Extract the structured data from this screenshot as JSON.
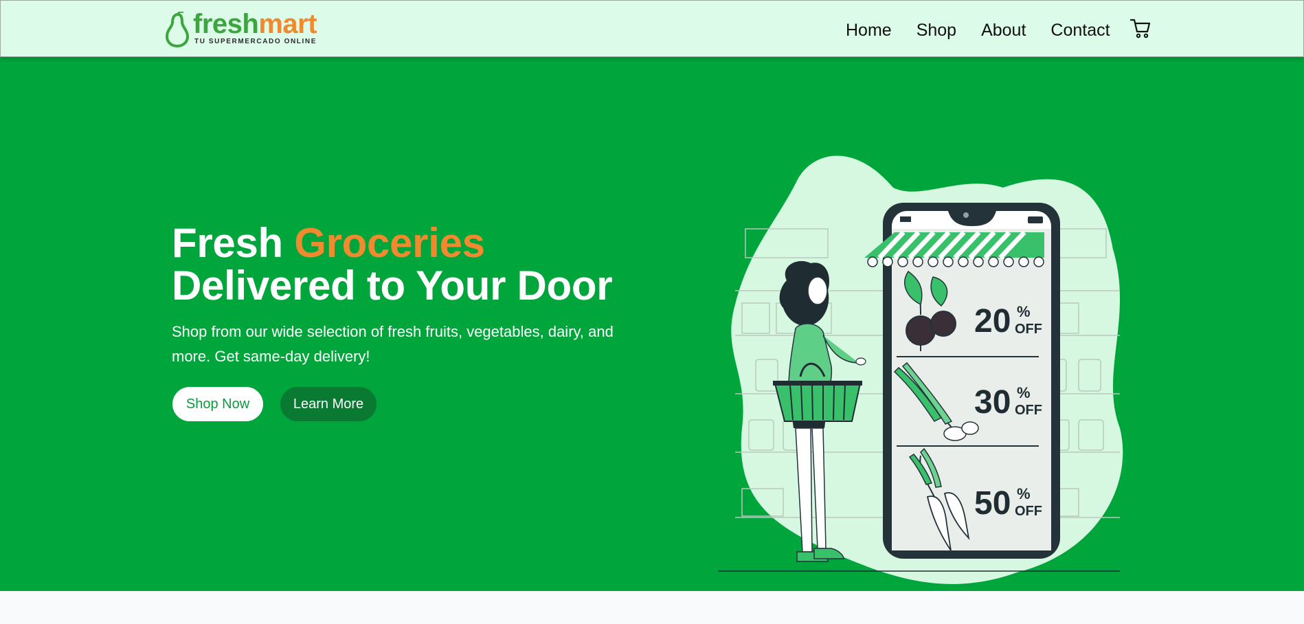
{
  "brand": {
    "name_part1": "fresh",
    "name_part2": "mart",
    "tagline": "TU SUPERMERCADO ONLINE",
    "colors": {
      "green": "#3aa63c",
      "orange": "#f18a2e"
    },
    "icon": "pear-icon"
  },
  "nav": {
    "links": [
      "Home",
      "Shop",
      "About",
      "Contact"
    ],
    "cart_icon": "cart-icon"
  },
  "hero": {
    "title_line1_part1": "Fresh ",
    "title_line1_accent": "Groceries",
    "title_line2": "Delivered to Your Door",
    "subtitle": "Shop from our wide selection of fresh fruits, vegetables, dairy, and more. Get same-day delivery!",
    "primary_button": "Shop Now",
    "secondary_button": "Learn More",
    "background": "#00a63c"
  },
  "illustration": {
    "offers": [
      {
        "percent": "20",
        "suffix_top": "%",
        "suffix_bottom": "OFF",
        "item": "beet-icon"
      },
      {
        "percent": "30",
        "suffix_top": "%",
        "suffix_bottom": "OFF",
        "item": "scallion-icon"
      },
      {
        "percent": "50",
        "suffix_top": "%",
        "suffix_bottom": "OFF",
        "item": "carrot-icon"
      }
    ]
  }
}
